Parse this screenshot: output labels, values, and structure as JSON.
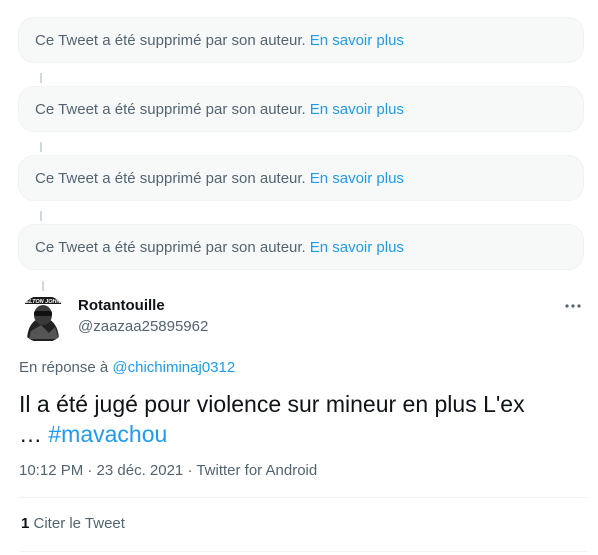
{
  "deleted_tweets": [
    {
      "message": "Ce Tweet a été supprimé par son auteur.",
      "link": "En savoir plus"
    },
    {
      "message": "Ce Tweet a été supprimé par son auteur.",
      "link": "En savoir plus"
    },
    {
      "message": "Ce Tweet a été supprimé par son auteur.",
      "link": "En savoir plus"
    },
    {
      "message": "Ce Tweet a été supprimé par son auteur.",
      "link": "En savoir plus"
    }
  ],
  "tweet": {
    "author": {
      "display_name": "Rotantouille",
      "handle": "@zaazaa25895962",
      "avatar_text": "ELTON JOHN"
    },
    "more_icon": "more-horizontal-icon",
    "reply_prefix": "En réponse à",
    "reply_to": "@chichiminaj0312",
    "text_part1": "Il a été jugé pour violence sur mineur en plus L'ex",
    "text_ellipsis": "…",
    "hashtag": "#mavachou",
    "timestamp": "10:12 PM · 23 déc. 2021 · Twitter for Android",
    "quote_count": "1",
    "quote_label": "Citer le Tweet"
  },
  "colors": {
    "link_blue": "#1d9bf0",
    "secondary_text": "#536471",
    "card_bg": "#f7f9f9"
  }
}
